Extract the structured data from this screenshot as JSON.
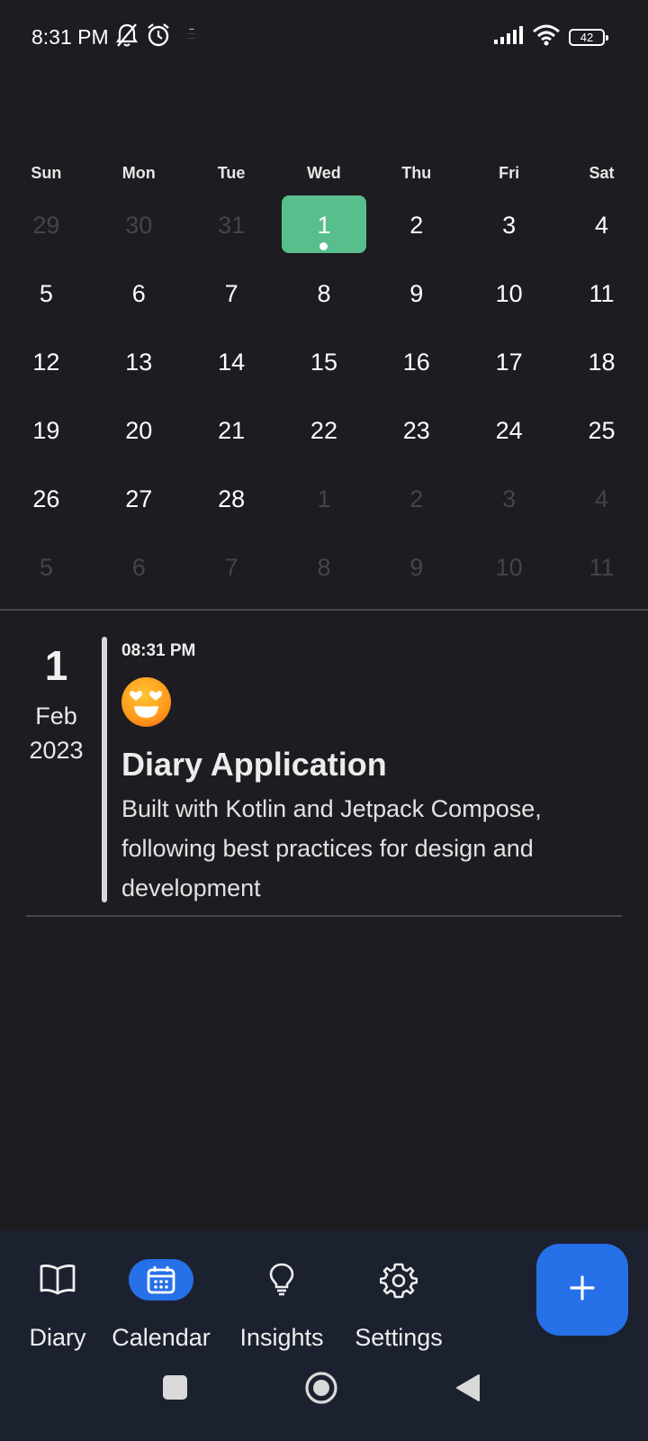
{
  "status_bar": {
    "time": "8:31 PM",
    "battery": "42",
    "icons": [
      "notifications-off-icon",
      "alarm-icon",
      "bbc-app-icon",
      "signal-icon",
      "wifi-icon",
      "battery-icon"
    ]
  },
  "calendar": {
    "weekdays": [
      "Sun",
      "Mon",
      "Tue",
      "Wed",
      "Thu",
      "Fri",
      "Sat"
    ],
    "weeks": [
      [
        "29",
        "30",
        "31",
        "1",
        "2",
        "3",
        "4"
      ],
      [
        "5",
        "6",
        "7",
        "8",
        "9",
        "10",
        "11"
      ],
      [
        "12",
        "13",
        "14",
        "15",
        "16",
        "17",
        "18"
      ],
      [
        "19",
        "20",
        "21",
        "22",
        "23",
        "24",
        "25"
      ],
      [
        "26",
        "27",
        "28",
        "1",
        "2",
        "3",
        "4"
      ],
      [
        "5",
        "6",
        "7",
        "8",
        "9",
        "10",
        "11"
      ]
    ],
    "selected_color": "#58be8c"
  },
  "entry": {
    "day": "1",
    "month": "Feb",
    "year": "2023",
    "time": "08:31 PM",
    "mood_icon": "smiling-face-with-heart-eyes-icon",
    "title": "Diary Application",
    "body": "Built with Kotlin and Jetpack Compose, following best practices for design and development"
  },
  "bottom_nav": {
    "items": [
      {
        "label": "Diary",
        "icon": "book-icon"
      },
      {
        "label": "Calendar",
        "icon": "calendar-icon",
        "active": true
      },
      {
        "label": "Insights",
        "icon": "lightbulb-icon"
      },
      {
        "label": "Settings",
        "icon": "gear-icon"
      }
    ],
    "fab_icon": "plus-icon",
    "accent": "#2670e8"
  },
  "system_nav": [
    "recents-icon",
    "home-icon",
    "back-icon"
  ]
}
